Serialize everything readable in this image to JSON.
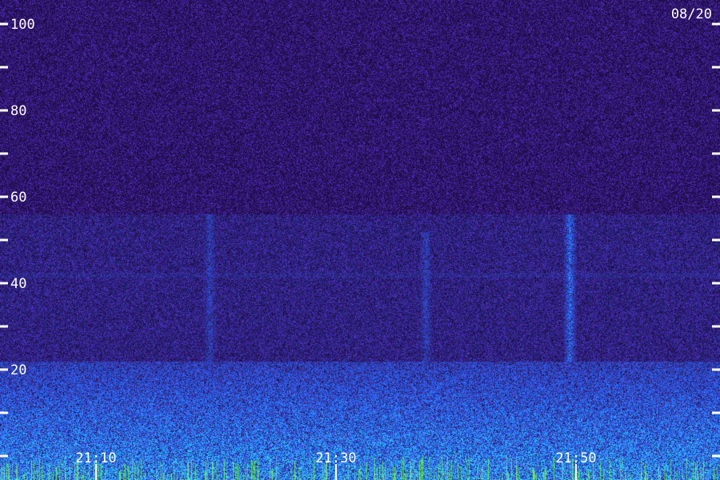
{
  "date_label": "08/20",
  "chart_data": {
    "type": "heatmap",
    "title": "",
    "xlabel": "",
    "ylabel": "",
    "ylim": [
      0,
      100
    ],
    "y_ticks_labeled": [
      "100",
      "80",
      "60",
      "40",
      "20"
    ],
    "y_tick_values_labeled": [
      100,
      80,
      60,
      40,
      20
    ],
    "y_tick_values_unlabeled": [
      90,
      70,
      50,
      30,
      10,
      0
    ],
    "x_tick_labels": [
      "21:10",
      "21:30",
      "21:50"
    ],
    "xlim_time": [
      "21:02",
      "22:02"
    ],
    "colors": {
      "background": "#2a1478",
      "noise_low": "#1a0a40",
      "noise_high": "#5a30c8",
      "signal_mid": "#2e6cff",
      "signal_high": "#2fd6ff",
      "signal_peak": "#7dff5a",
      "tick": "#ffffff"
    },
    "features": [
      {
        "kind": "band",
        "y_from": 0,
        "y_to": 22,
        "intensity": "high"
      },
      {
        "kind": "streak",
        "time": "21:50",
        "y_from": 22,
        "y_to": 56,
        "intensity": "mid-high"
      },
      {
        "kind": "streak",
        "time": "21:20",
        "y_from": 22,
        "y_to": 56,
        "intensity": "mid"
      },
      {
        "kind": "streak",
        "time": "21:38",
        "y_from": 22,
        "y_to": 52,
        "intensity": "mid"
      },
      {
        "kind": "line",
        "y": 42,
        "intensity": "low"
      }
    ]
  }
}
